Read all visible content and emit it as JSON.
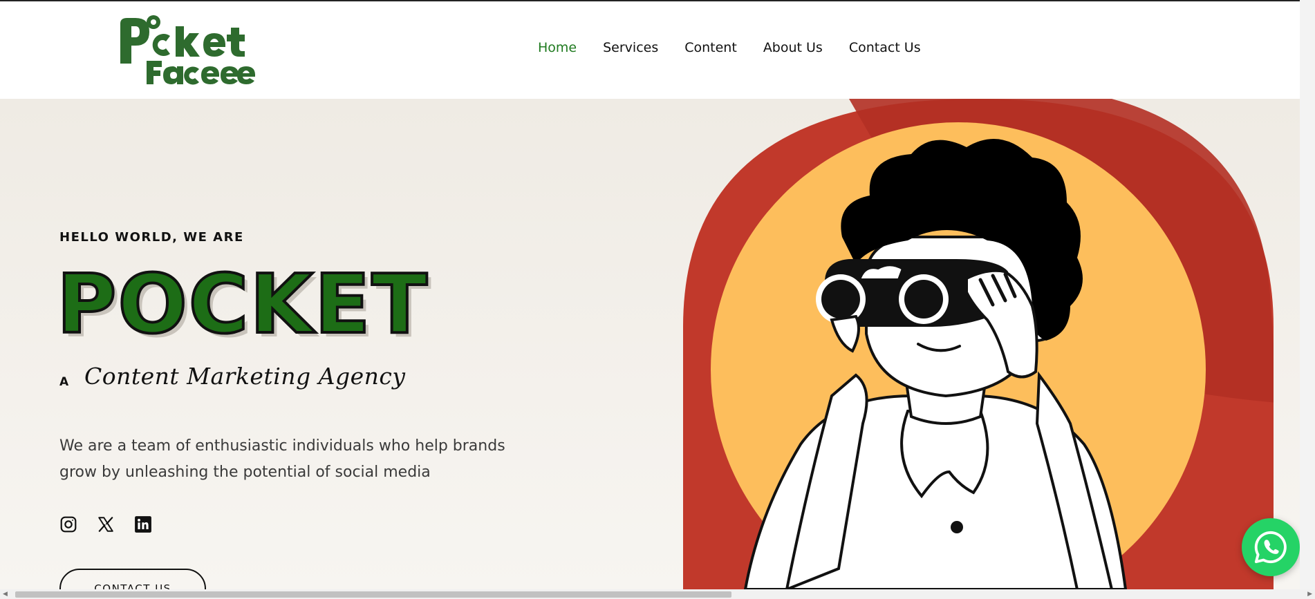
{
  "logo": {
    "line1": "Pocket",
    "line2": "Faceee",
    "color": "#2e6b2e"
  },
  "nav": {
    "items": [
      {
        "label": "Home",
        "active": true
      },
      {
        "label": "Services",
        "active": false
      },
      {
        "label": "Content",
        "active": false
      },
      {
        "label": "About Us",
        "active": false
      },
      {
        "label": "Contact Us",
        "active": false
      }
    ],
    "active_color": "#1f7a1f"
  },
  "hero": {
    "eyebrow": "HELLO WORLD, WE ARE",
    "title": "POCKET",
    "tagline_prefix": "A",
    "tagline": "Content Marketing Agency",
    "description": "We are a team of enthusiastic individuals who help brands grow by unleashing the potential of social media",
    "cta_label": "CONTACT US",
    "title_color": "#1d6d16"
  },
  "socials": [
    "instagram-icon",
    "x-twitter-icon",
    "linkedin-icon"
  ],
  "illustration": {
    "outer_color": "#c0392b",
    "inner_color": "#fdbe5c",
    "subject": "person-with-binoculars"
  },
  "whatsapp": {
    "icon": "whatsapp-icon",
    "color": "#25d366"
  }
}
